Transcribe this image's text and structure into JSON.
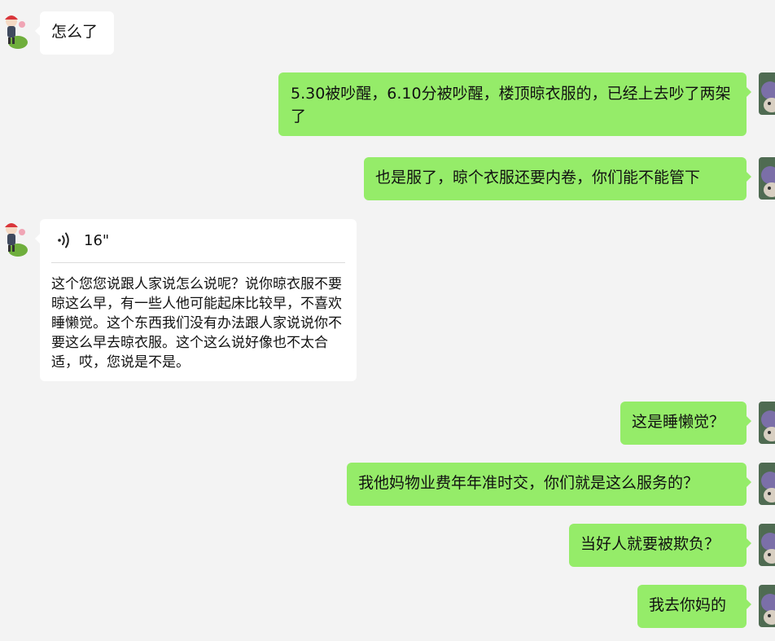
{
  "chat": {
    "messages": [
      {
        "sender": "other",
        "text": "怎么了"
      },
      {
        "sender": "me",
        "text": "5.30被吵醒，6.10分被吵醒，楼顶晾衣服的，已经上去吵了两架了"
      },
      {
        "sender": "me",
        "text": "也是服了，晾个衣服还要内卷，你们能不能管下"
      },
      {
        "sender": "other",
        "type": "voice",
        "duration": "16\"",
        "transcript": "这个您您说跟人家说怎么说呢？说你晾衣服不要晾这么早，有一些人他可能起床比较早，不喜欢睡懒觉。这个东西我们没有办法跟人家说说你不要这么早去晾衣服。这个这么说好像也不太合适，哎，您说是不是。"
      },
      {
        "sender": "me",
        "text": "这是睡懒觉？"
      },
      {
        "sender": "me",
        "text": "我他妈物业费年年准时交，你们就是这么服务的？"
      },
      {
        "sender": "me",
        "text": "当好人就要被欺负？"
      },
      {
        "sender": "me",
        "text": "我去你妈的"
      }
    ]
  },
  "colors": {
    "background": "#f3f3f3",
    "incoming_bubble": "#ffffff",
    "outgoing_bubble": "#95ec69"
  },
  "icons": {
    "voice": "voice-wave-icon",
    "avatar_other": "cartoon-avatar-icon",
    "avatar_me": "photo-avatar-icon"
  }
}
